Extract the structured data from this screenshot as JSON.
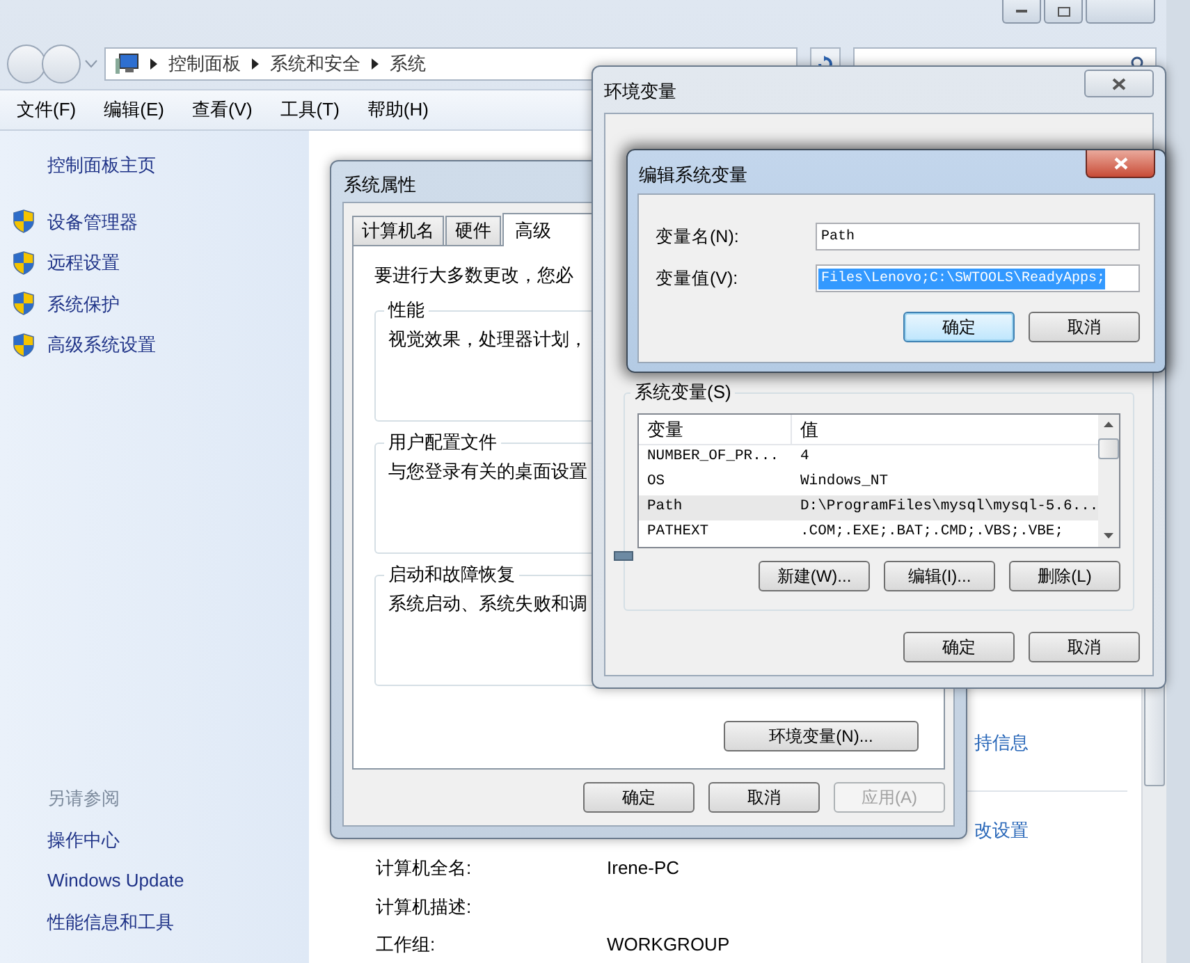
{
  "explorer": {
    "breadcrumb": [
      "控制面板",
      "系统和安全",
      "系统"
    ],
    "menu": [
      "文件(F)",
      "编辑(E)",
      "查看(V)",
      "工具(T)",
      "帮助(H)"
    ],
    "sidebar": {
      "home": "控制面板主页",
      "tasks": [
        "设备管理器",
        "远程设置",
        "系统保护",
        "高级系统设置"
      ],
      "see_also": "另请参阅",
      "links": [
        "操作中心",
        "Windows Update",
        "性能信息和工具"
      ]
    },
    "details": {
      "links": [
        "持信息",
        "改设置"
      ],
      "fields": [
        {
          "label": "计算机全名:",
          "value": "Irene-PC"
        },
        {
          "label": "计算机描述:"
        },
        {
          "label": "工作组:",
          "value": "WORKGROUP"
        }
      ]
    }
  },
  "system_properties": {
    "title": "系统属性",
    "tabs": [
      {
        "label": "计算机名",
        "selected": false
      },
      {
        "label": "硬件",
        "selected": false
      },
      {
        "label": "高级",
        "selected": true
      }
    ],
    "intro": "要进行大多数更改，您必",
    "groups": [
      {
        "title": "性能",
        "text": "视觉效果，处理器计划，"
      },
      {
        "title": "用户配置文件",
        "text": "与您登录有关的桌面设置"
      },
      {
        "title": "启动和故障恢复",
        "text": "系统启动、系统失败和调"
      }
    ],
    "env_button": "环境变量(N)...",
    "buttons": [
      {
        "label": "确定",
        "disabled": false
      },
      {
        "label": "取消",
        "disabled": false
      },
      {
        "label": "应用(A)",
        "disabled": true
      }
    ]
  },
  "environment_variables": {
    "title": "环境变量",
    "system_vars": {
      "label": "系统变量(S)",
      "columns": [
        "变量",
        "值"
      ],
      "rows": [
        {
          "name": "NUMBER_OF_PR...",
          "value": "4",
          "selected": false
        },
        {
          "name": "OS",
          "value": "Windows_NT",
          "selected": false
        },
        {
          "name": "Path",
          "value": "D:\\ProgramFiles\\mysql\\mysql-5.6...",
          "selected": true
        },
        {
          "name": "PATHEXT",
          "value": ".COM;.EXE;.BAT;.CMD;.VBS;.VBE;",
          "selected": false
        }
      ]
    },
    "list_buttons": [
      "新建(W)...",
      "编辑(I)...",
      "删除(L)"
    ],
    "buttons": [
      "确定",
      "取消"
    ]
  },
  "edit_dialog": {
    "title": "编辑系统变量",
    "fields": [
      {
        "label": "变量名(N):",
        "value": "Path",
        "selected": false
      },
      {
        "label": "变量值(V):",
        "value": "Files\\Lenovo;C:\\SWTOOLS\\ReadyApps;",
        "selected": true
      }
    ],
    "buttons": [
      {
        "label": "确定",
        "focused": true
      },
      {
        "label": "取消",
        "focused": false
      }
    ]
  }
}
